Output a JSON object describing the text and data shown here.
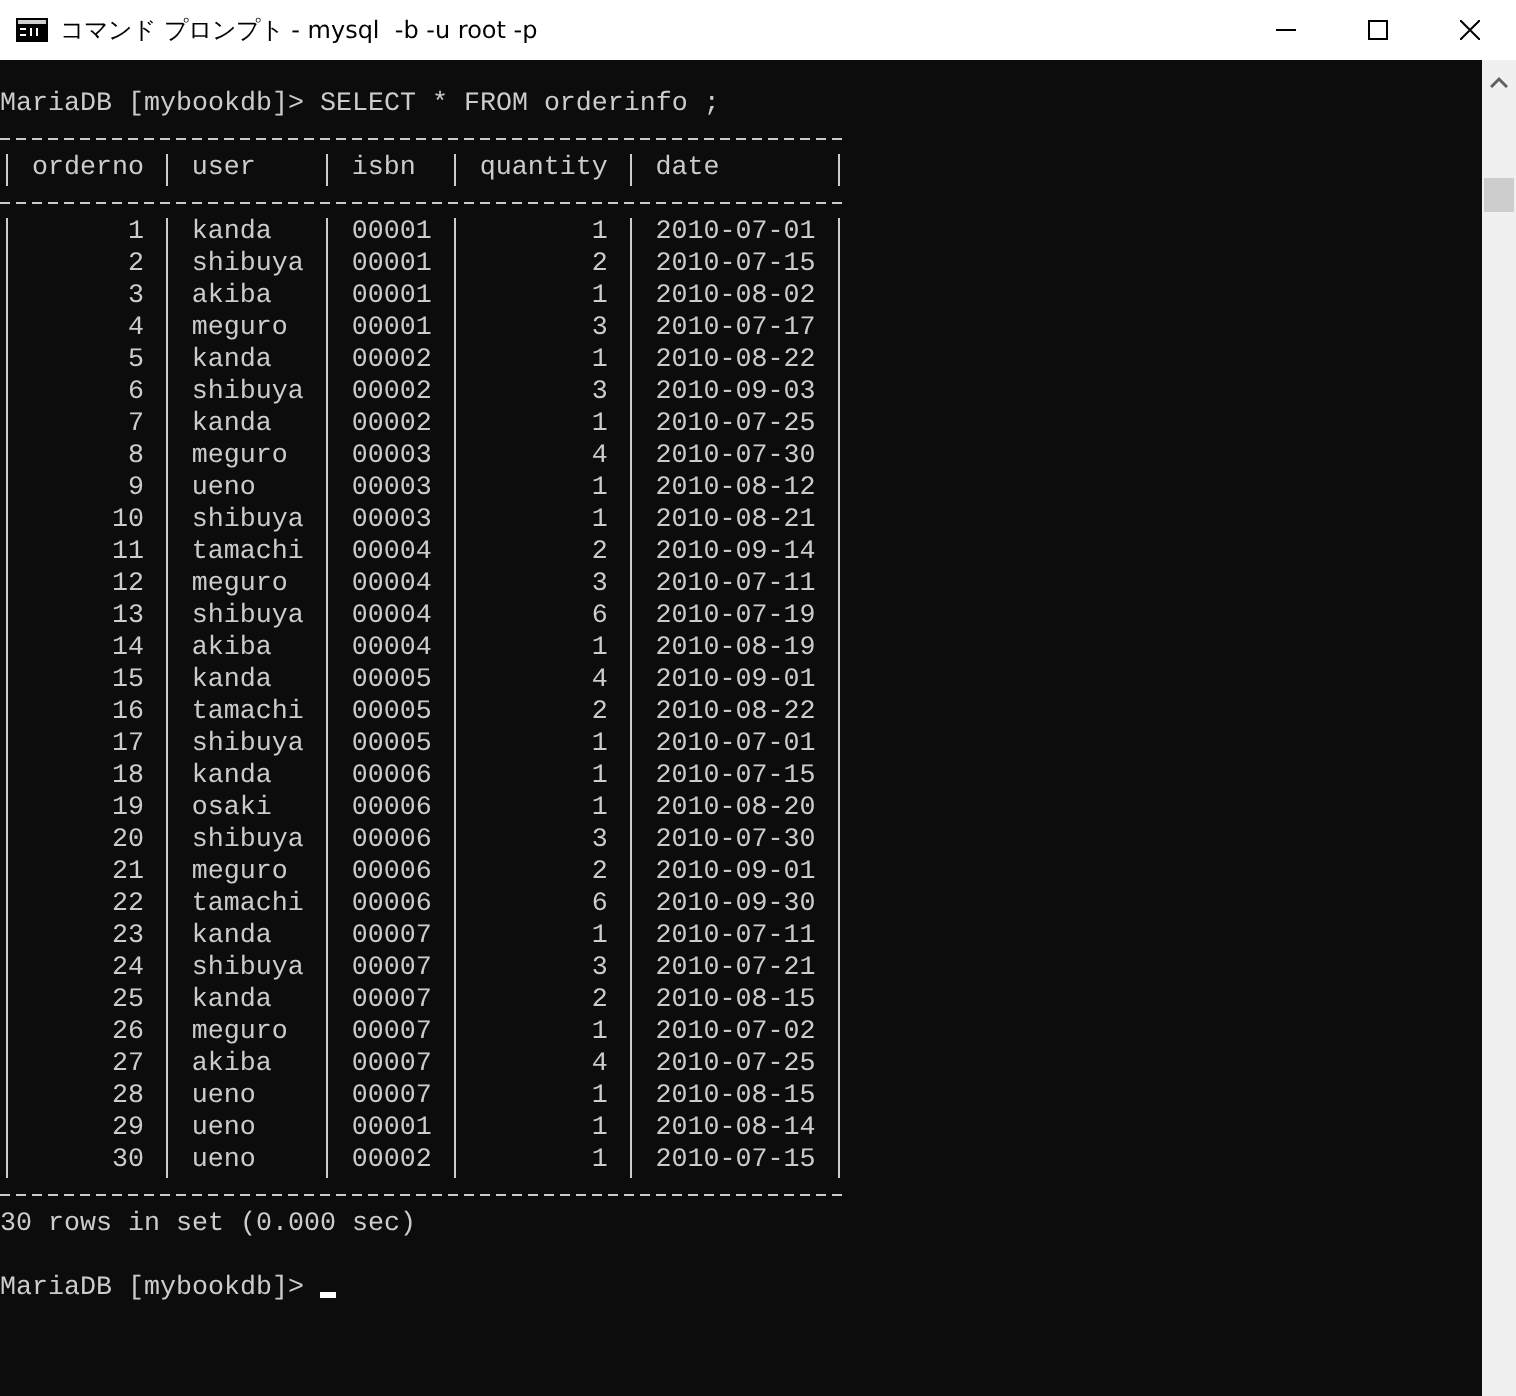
{
  "window": {
    "title": "コマンド プロンプト - mysql  -b -u root -p"
  },
  "console": {
    "command_line": "MariaDB [mybookdb]> SELECT * FROM orderinfo ;",
    "table": {
      "columns": [
        {
          "label": "orderno",
          "kind": "number"
        },
        {
          "label": "user",
          "kind": "text"
        },
        {
          "label": "isbn",
          "kind": "text"
        },
        {
          "label": "quantity",
          "kind": "number"
        },
        {
          "label": "date",
          "kind": "text"
        }
      ],
      "rows": [
        [
          "1",
          "kanda",
          "00001",
          "1",
          "2010-07-01"
        ],
        [
          "2",
          "shibuya",
          "00001",
          "2",
          "2010-07-15"
        ],
        [
          "3",
          "akiba",
          "00001",
          "1",
          "2010-08-02"
        ],
        [
          "4",
          "meguro",
          "00001",
          "3",
          "2010-07-17"
        ],
        [
          "5",
          "kanda",
          "00002",
          "1",
          "2010-08-22"
        ],
        [
          "6",
          "shibuya",
          "00002",
          "3",
          "2010-09-03"
        ],
        [
          "7",
          "kanda",
          "00002",
          "1",
          "2010-07-25"
        ],
        [
          "8",
          "meguro",
          "00003",
          "4",
          "2010-07-30"
        ],
        [
          "9",
          "ueno",
          "00003",
          "1",
          "2010-08-12"
        ],
        [
          "10",
          "shibuya",
          "00003",
          "1",
          "2010-08-21"
        ],
        [
          "11",
          "tamachi",
          "00004",
          "2",
          "2010-09-14"
        ],
        [
          "12",
          "meguro",
          "00004",
          "3",
          "2010-07-11"
        ],
        [
          "13",
          "shibuya",
          "00004",
          "6",
          "2010-07-19"
        ],
        [
          "14",
          "akiba",
          "00004",
          "1",
          "2010-08-19"
        ],
        [
          "15",
          "kanda",
          "00005",
          "4",
          "2010-09-01"
        ],
        [
          "16",
          "tamachi",
          "00005",
          "2",
          "2010-08-22"
        ],
        [
          "17",
          "shibuya",
          "00005",
          "1",
          "2010-07-01"
        ],
        [
          "18",
          "kanda",
          "00006",
          "1",
          "2010-07-15"
        ],
        [
          "19",
          "osaki",
          "00006",
          "1",
          "2010-08-20"
        ],
        [
          "20",
          "shibuya",
          "00006",
          "3",
          "2010-07-30"
        ],
        [
          "21",
          "meguro",
          "00006",
          "2",
          "2010-09-01"
        ],
        [
          "22",
          "tamachi",
          "00006",
          "6",
          "2010-09-30"
        ],
        [
          "23",
          "kanda",
          "00007",
          "1",
          "2010-07-11"
        ],
        [
          "24",
          "shibuya",
          "00007",
          "3",
          "2010-07-21"
        ],
        [
          "25",
          "kanda",
          "00007",
          "2",
          "2010-08-15"
        ],
        [
          "26",
          "meguro",
          "00007",
          "1",
          "2010-07-02"
        ],
        [
          "27",
          "akiba",
          "00007",
          "4",
          "2010-07-25"
        ],
        [
          "28",
          "ueno",
          "00007",
          "1",
          "2010-08-15"
        ],
        [
          "29",
          "ueno",
          "00001",
          "1",
          "2010-08-14"
        ],
        [
          "30",
          "ueno",
          "00002",
          "1",
          "2010-07-15"
        ]
      ]
    },
    "status_line": "30 rows in set (0.000 sec)",
    "prompt": "MariaDB [mybookdb]>",
    "cursor": true
  }
}
